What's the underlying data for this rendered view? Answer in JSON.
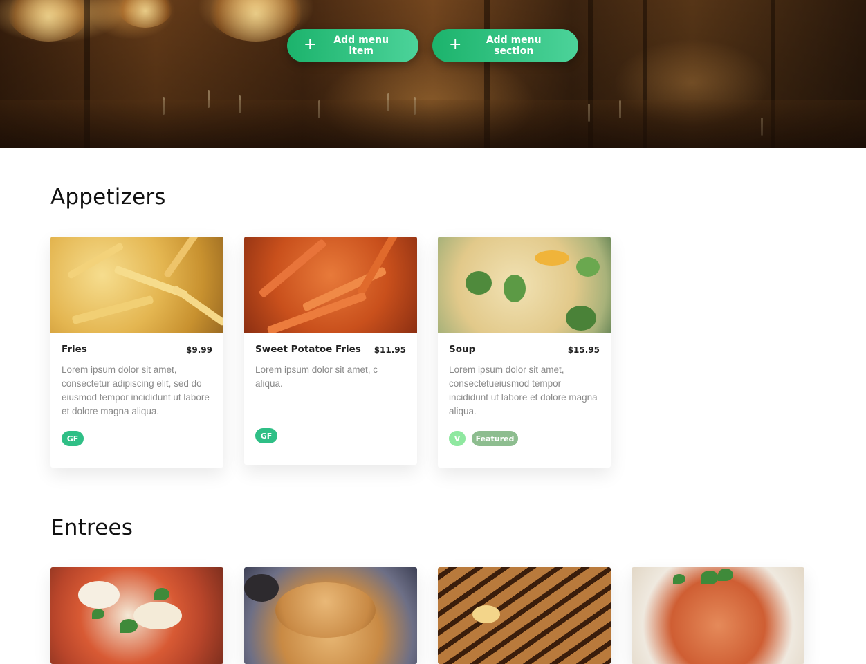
{
  "hero": {
    "add_item_label": "Add menu item",
    "add_section_label": "Add menu section"
  },
  "colors": {
    "button_gradient": [
      "#1cb36c",
      "#4cd39a"
    ],
    "tag_gf": "#2fbf86",
    "tag_v": "#8fe8a0",
    "tag_featured": "#8dbd8f"
  },
  "sections": [
    {
      "title": "Appetizers",
      "items": [
        {
          "name": "Fries",
          "price": "$9.99",
          "description": "Lorem ipsum dolor sit amet, consectetur adipiscing elit, sed do eiusmod tempor incididunt ut labore et dolore magna aliqua.",
          "tags": [
            "GF"
          ]
        },
        {
          "name": "Sweet Potatoe Fries",
          "price": "$11.95",
          "description": "Lorem ipsum dolor sit amet, c aliqua.",
          "tags": [
            "GF"
          ]
        },
        {
          "name": "Soup",
          "price": "$15.95",
          "description": "Lorem ipsum dolor sit amet, consectetueiusmod tempor incididunt ut labore et dolore magna aliqua.",
          "tags": [
            "V",
            "Featured"
          ]
        }
      ]
    },
    {
      "title": "Entrees",
      "items": [
        {
          "image_icon": "pizza-photo"
        },
        {
          "image_icon": "burger-photo"
        },
        {
          "image_icon": "sandwich-photo"
        },
        {
          "image_icon": "pasta-photo"
        }
      ]
    }
  ]
}
